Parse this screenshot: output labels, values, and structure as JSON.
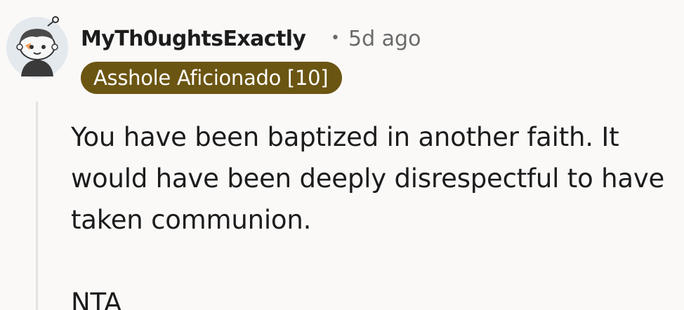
{
  "comment": {
    "author": {
      "username": "MyTh0ughtsExactly",
      "avatar_icon": "reddit-snoo-avatar-icon"
    },
    "timestamp": "5d ago",
    "separator": "•",
    "flair": {
      "text": "Asshole Aficionado [10]",
      "background": "#6b5512",
      "color": "#ffffff"
    },
    "body": {
      "paragraphs": [
        "You have been baptized in another faith. It would have been deeply disrespectful to have taken communion.",
        "NTA"
      ]
    }
  }
}
